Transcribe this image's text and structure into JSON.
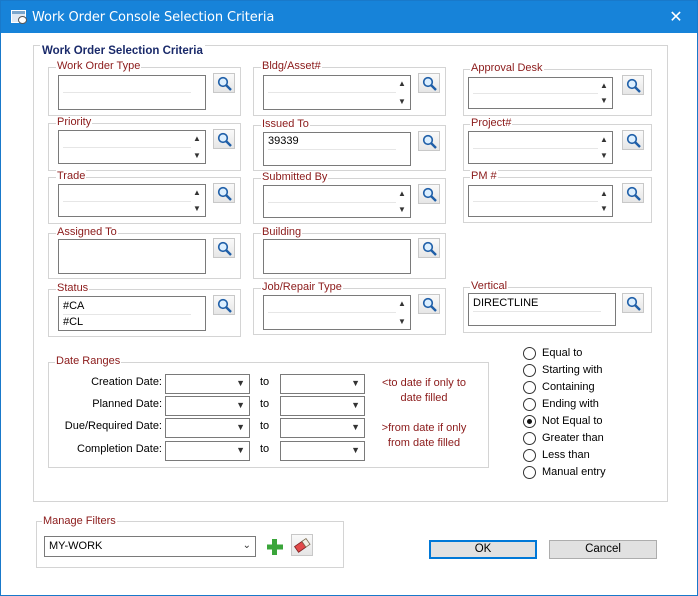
{
  "window": {
    "title": "Work Order Console Selection Criteria"
  },
  "criteria": {
    "caption": "Work Order Selection Criteria",
    "work_order_type": {
      "label": "Work Order Type",
      "values": []
    },
    "bldg_asset": {
      "label": "Bldg/Asset#",
      "values": []
    },
    "approval_desk": {
      "label": "Approval Desk",
      "values": []
    },
    "priority": {
      "label": "Priority",
      "values": []
    },
    "issued_to": {
      "label": "Issued To",
      "values": [
        "39339"
      ]
    },
    "project": {
      "label": "Project#",
      "values": []
    },
    "trade": {
      "label": "Trade",
      "values": []
    },
    "submitted_by": {
      "label": "Submitted By",
      "values": []
    },
    "pm": {
      "label": "PM #",
      "values": []
    },
    "assigned_to": {
      "label": "Assigned To",
      "values": []
    },
    "building": {
      "label": "Building",
      "values": []
    },
    "status": {
      "label": "Status",
      "values": [
        "#CA",
        "#CL"
      ]
    },
    "job_repair_type": {
      "label": "Job/Repair Type",
      "values": []
    },
    "vertical": {
      "label": "Vertical",
      "values": [
        "DIRECTLINE"
      ]
    }
  },
  "dates": {
    "caption": "Date Ranges",
    "to_label": "to",
    "rows": [
      {
        "label": "Creation Date:",
        "from": "",
        "to": ""
      },
      {
        "label": "Planned Date:",
        "from": "",
        "to": ""
      },
      {
        "label": "Due/Required Date:",
        "from": "",
        "to": ""
      },
      {
        "label": "Completion Date:",
        "from": "",
        "to": ""
      }
    ],
    "note_to_1": "<to date if only to",
    "note_to_2": "date filled",
    "note_from_1": ">from date if only",
    "note_from_2": "from date filled"
  },
  "match_mode": {
    "options": [
      {
        "label": "Equal to",
        "checked": false
      },
      {
        "label": "Starting with",
        "checked": false
      },
      {
        "label": "Containing",
        "checked": false
      },
      {
        "label": "Ending with",
        "checked": false
      },
      {
        "label": "Not Equal to",
        "checked": true
      },
      {
        "label": "Greater than",
        "checked": false
      },
      {
        "label": "Less than",
        "checked": false
      },
      {
        "label": "Manual entry",
        "checked": false
      }
    ]
  },
  "filters": {
    "caption": "Manage Filters",
    "selected": "MY-WORK"
  },
  "buttons": {
    "ok": "OK",
    "cancel": "Cancel"
  },
  "colors": {
    "title_bar": "#1783d9",
    "label_red": "#8b1a1a",
    "caption_navy": "#1a2a6a",
    "add_green": "#3aa53a"
  }
}
